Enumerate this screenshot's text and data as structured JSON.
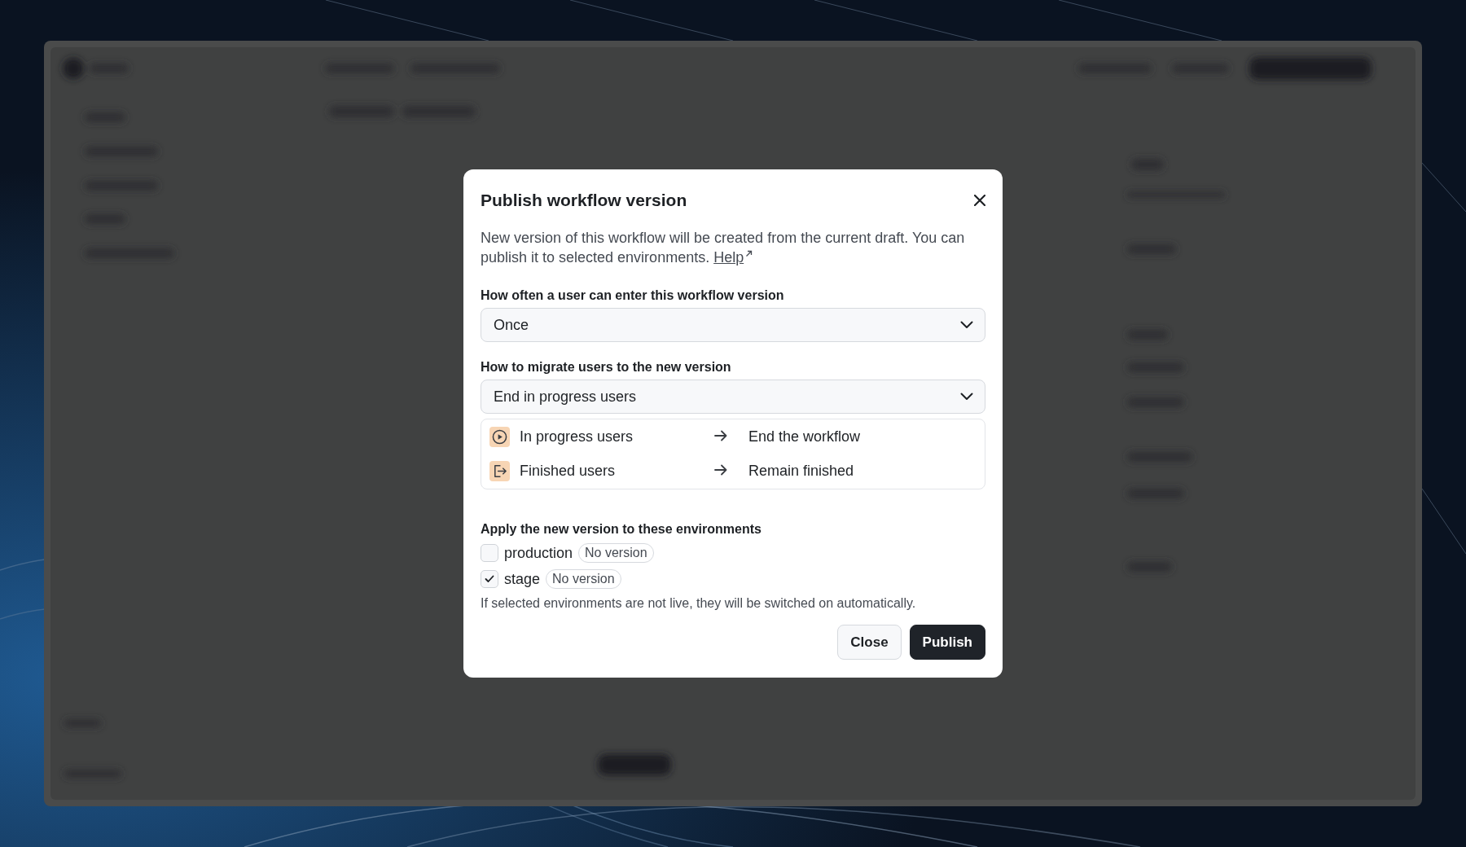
{
  "dialog": {
    "title": "Publish workflow version",
    "description": "New version of this workflow will be created from the current draft. You can publish it to selected environments.",
    "help_link": "Help",
    "fields": [
      {
        "label": "How often a user can enter this workflow version",
        "value": "Once"
      },
      {
        "label": "How to migrate users to the new version",
        "value": "End in progress users"
      }
    ],
    "migration": [
      {
        "kind": "play",
        "from": "In progress users",
        "to": "End the workflow"
      },
      {
        "kind": "exit",
        "from": "Finished users",
        "to": "Remain finished"
      }
    ],
    "environments_label": "Apply the new version to these environments",
    "environments": [
      {
        "name": "production",
        "checked": false,
        "badge": "No version"
      },
      {
        "name": "stage",
        "checked": true,
        "badge": "No version"
      }
    ],
    "note": "If selected environments are not live, they will be switched on automatically.",
    "buttons": [
      {
        "label": "Close",
        "kind": "secondary"
      },
      {
        "label": "Publish",
        "kind": "primary"
      }
    ]
  }
}
